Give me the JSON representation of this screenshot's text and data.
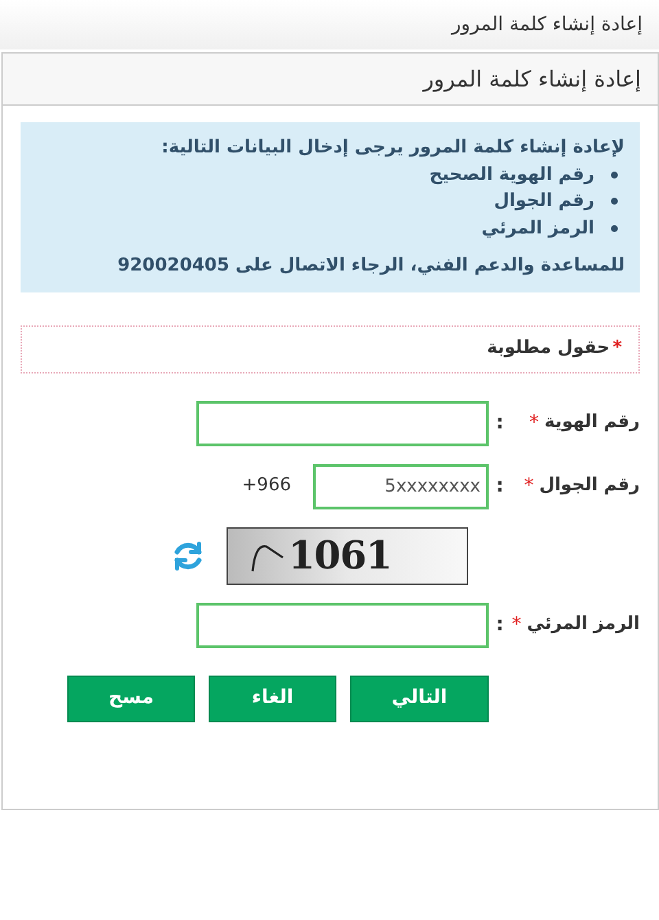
{
  "page_title": "إعادة إنشاء كلمة المرور",
  "panel": {
    "title": "إعادة إنشاء كلمة المرور",
    "info": {
      "intro": "لإعادة إنشاء كلمة المرور يرجى إدخال البيانات التالية:",
      "items": [
        "رقم الهوية الصحيح",
        "رقم الجوال",
        "الرمز المرئي"
      ],
      "support": "للمساعدة والدعم الفني، الرجاء الاتصال على 920020405"
    },
    "required_note": {
      "mark": "*",
      "text": "حقول مطلوبة"
    },
    "fields": [
      {
        "kind": "text",
        "label": "رقم الهوية",
        "mark": "*",
        "colon": ":"
      },
      {
        "kind": "phone",
        "label": "رقم الجوال",
        "mark": "*",
        "colon": ":",
        "placeholder": "5xxxxxxxx",
        "prefix": "+966"
      },
      {
        "kind": "captcha",
        "code": "1061"
      },
      {
        "kind": "text",
        "label": "الرمز المرئي",
        "mark": "*",
        "colon": ":"
      }
    ],
    "buttons": [
      "التالي",
      "الغاء",
      "مسح"
    ]
  }
}
